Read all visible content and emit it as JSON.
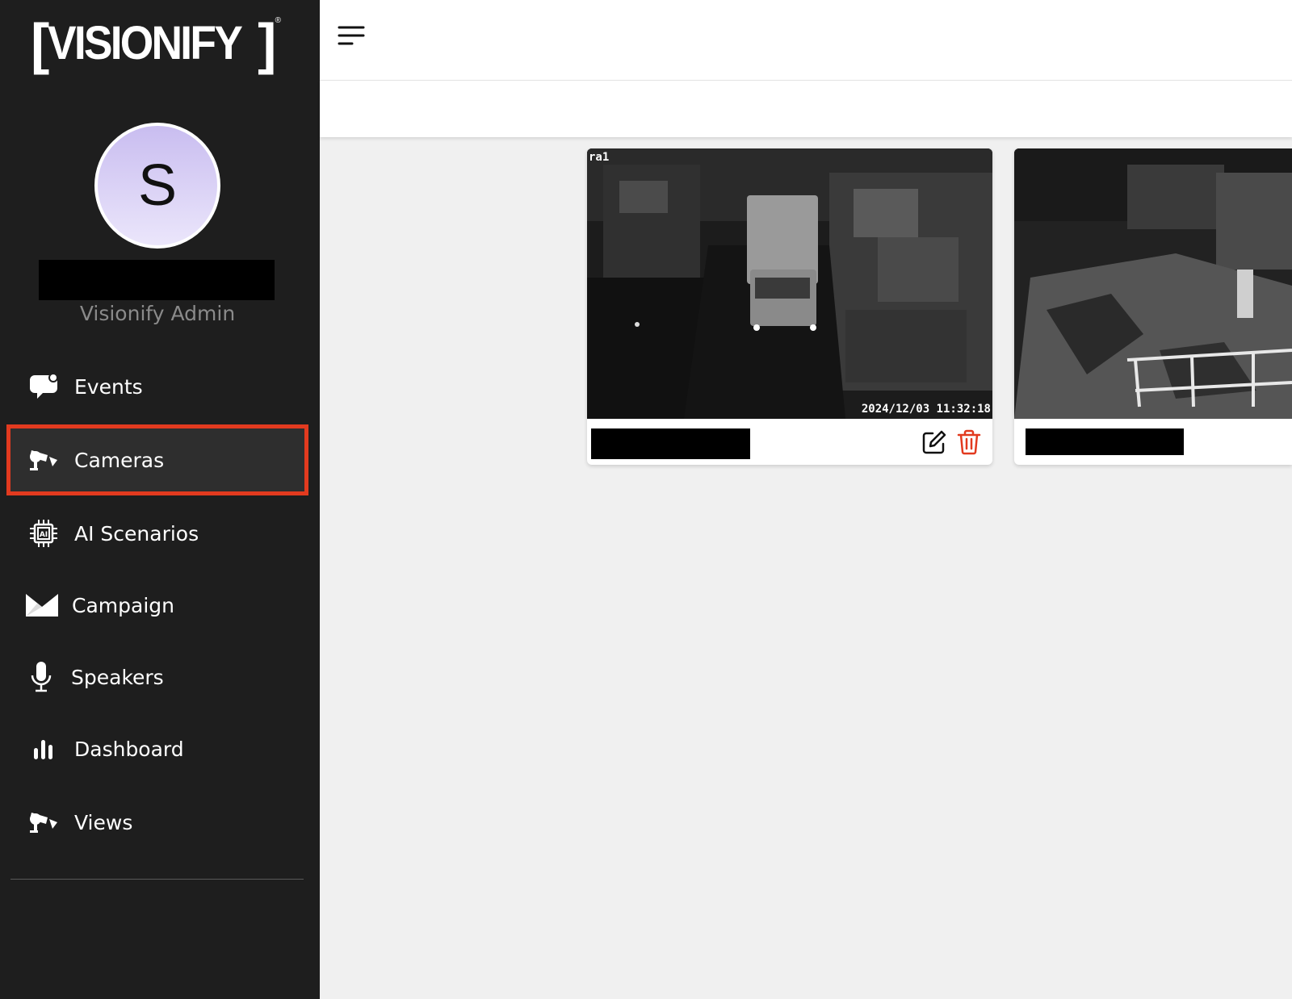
{
  "brand": {
    "logo_text": "VISIONIFY",
    "bracket_left": "[",
    "bracket_right": "]",
    "registered": "®"
  },
  "user": {
    "avatar_initial": "S",
    "role": "Visionify Admin"
  },
  "sidebar": {
    "items": [
      {
        "label": "Events",
        "icon": "chat-bubble-icon",
        "active": false
      },
      {
        "label": "Cameras",
        "icon": "security-camera-icon",
        "active": true
      },
      {
        "label": "AI Scenarios",
        "icon": "ai-chip-icon",
        "active": false
      },
      {
        "label": "Campaign",
        "icon": "envelope-icon",
        "active": false
      },
      {
        "label": "Speakers",
        "icon": "microphone-icon",
        "active": false
      },
      {
        "label": "Dashboard",
        "icon": "bar-chart-icon",
        "active": false
      },
      {
        "label": "Views",
        "icon": "security-camera-icon",
        "active": false
      }
    ]
  },
  "header": {
    "menu_icon": "hamburger-menu-icon"
  },
  "cameras": [
    {
      "overlay_label": "ra1",
      "overlay_timestamp": "2024/12/03 11:32:18",
      "actions": {
        "edit_icon": "edit-icon",
        "delete_icon": "trash-icon"
      }
    },
    {
      "overlay_label": "",
      "overlay_timestamp": ""
    }
  ],
  "colors": {
    "sidebar_bg": "#1e1e1e",
    "active_outline": "#e23a1f",
    "delete_red": "#e23a1f",
    "content_bg": "#f0f0f0",
    "role_text": "#8a8a8a"
  }
}
